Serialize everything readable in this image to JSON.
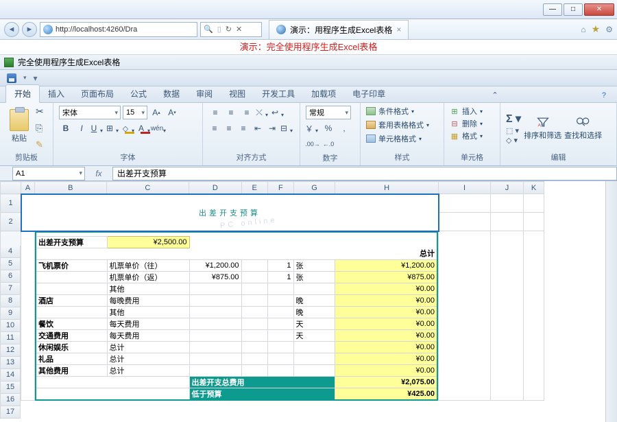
{
  "window": {
    "url": "http://localhost:4260/Dra",
    "tab_title": "演示：用程序生成Excel表格"
  },
  "banner": "演示：完全使用程序生成Excel表格",
  "doc_title": "完全使用程序生成Excel表格",
  "ribbon_tabs": [
    "开始",
    "插入",
    "页面布局",
    "公式",
    "数据",
    "审阅",
    "视图",
    "开发工具",
    "加载项",
    "电子印章"
  ],
  "ribbon": {
    "clipboard": {
      "paste": "粘贴",
      "label": "剪贴板"
    },
    "font": {
      "name": "宋体",
      "size": "15",
      "label": "字体"
    },
    "align": {
      "label": "对齐方式"
    },
    "number": {
      "format": "常规",
      "label": "数字"
    },
    "styles": {
      "cond": "条件格式",
      "table": "套用表格格式",
      "cell": "单元格格式",
      "label": "样式"
    },
    "cells": {
      "insert": "插入",
      "delete": "删除",
      "format": "格式",
      "label": "单元格"
    },
    "editing": {
      "sort": "排序和筛选",
      "find": "查找和选择",
      "label": "编辑"
    }
  },
  "cellref": "A1",
  "formula": "出差开支预算",
  "cols": [
    "A",
    "B",
    "C",
    "D",
    "E",
    "F",
    "G",
    "H",
    "I",
    "J",
    "K"
  ],
  "sheet": {
    "title": "出差开支预算",
    "r4": {
      "label": "出差开支预算",
      "val": "¥2,500.00"
    },
    "r5": {
      "total": "总计"
    },
    "rows": [
      {
        "n": "6",
        "cat": "飞机票价",
        "desc": "机票单价（往）",
        "d": "¥1,200.00",
        "e": "",
        "f": "1",
        "g": "张",
        "h": "¥1,200.00"
      },
      {
        "n": "7",
        "cat": "",
        "desc": "机票单价（返）",
        "d": "¥875.00",
        "e": "",
        "f": "1",
        "g": "张",
        "h": "¥875.00"
      },
      {
        "n": "8",
        "cat": "",
        "desc": "其他",
        "d": "",
        "e": "",
        "f": "",
        "g": "",
        "h": "¥0.00"
      },
      {
        "n": "9",
        "cat": "酒店",
        "desc": "每晚费用",
        "d": "",
        "e": "",
        "f": "",
        "g": "晚",
        "h": "¥0.00"
      },
      {
        "n": "10",
        "cat": "",
        "desc": "其他",
        "d": "",
        "e": "",
        "f": "",
        "g": "晚",
        "h": "¥0.00"
      },
      {
        "n": "11",
        "cat": "餐饮",
        "desc": "每天费用",
        "d": "",
        "e": "",
        "f": "",
        "g": "天",
        "h": "¥0.00"
      },
      {
        "n": "12",
        "cat": "交通费用",
        "desc": "每天费用",
        "d": "",
        "e": "",
        "f": "",
        "g": "天",
        "h": "¥0.00"
      },
      {
        "n": "13",
        "cat": "休闲娱乐",
        "desc": "总计",
        "d": "",
        "e": "",
        "f": "",
        "g": "",
        "h": "¥0.00"
      },
      {
        "n": "14",
        "cat": "礼品",
        "desc": "总计",
        "d": "",
        "e": "",
        "f": "",
        "g": "",
        "h": "¥0.00"
      },
      {
        "n": "15",
        "cat": "其他费用",
        "desc": "总计",
        "d": "",
        "e": "",
        "f": "",
        "g": "",
        "h": "¥0.00"
      }
    ],
    "totals": {
      "total_label": "出差开支总费用",
      "total_val": "¥2,075.00",
      "under_label": "低于预算",
      "under_val": "¥425.00"
    }
  }
}
